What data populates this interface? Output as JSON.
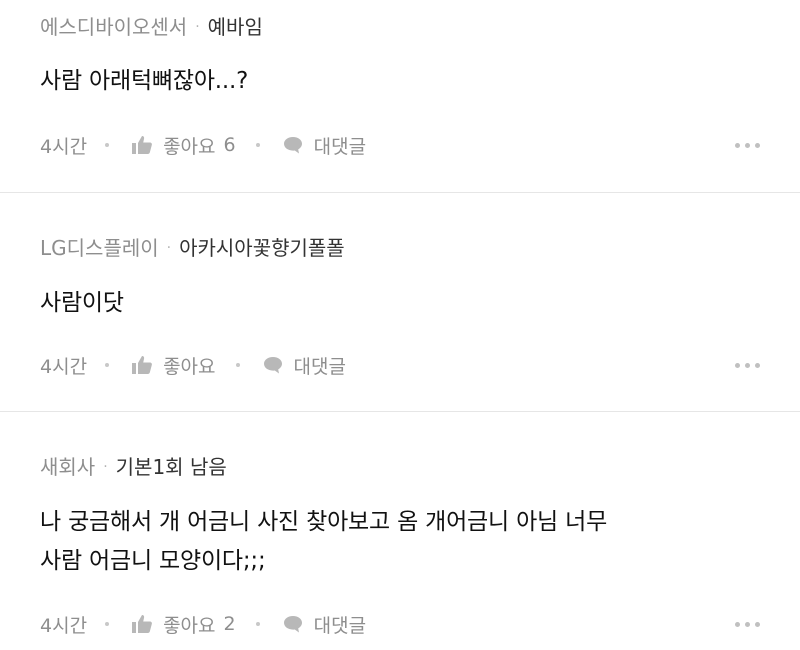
{
  "comments": [
    {
      "company": "에스디바이오센서",
      "separator": "·",
      "nickname": "예바임",
      "text": "사람 아래턱뼈잖아...?",
      "time": "4시간",
      "like_label": "좋아요",
      "like_count": "6",
      "reply_label": "대댓글"
    },
    {
      "company": "LG디스플레이",
      "separator": "·",
      "nickname": "아카시아꽃향기폴폴",
      "text": "사람이닷",
      "time": "4시간",
      "like_label": "좋아요",
      "like_count": "",
      "reply_label": "대댓글"
    },
    {
      "company": "새회사",
      "separator": "·",
      "nickname": "기본1회 남음",
      "text_lines": [
        "나 궁금해서 개 어금니 사진 찾아보고 옴 개어금니 아님 너무",
        "사람 어금니 모양이다;;;"
      ],
      "time": "4시간",
      "like_label": "좋아요",
      "like_count": "2",
      "reply_label": "대댓글"
    }
  ],
  "icons": {
    "like": "thumbs-up-icon",
    "reply": "speech-bubble-icon",
    "more": "more-horizontal-icon"
  },
  "colors": {
    "muted_text": "#8e8e8e",
    "divider": "#e6e6e6",
    "icon": "#b8b8b8"
  }
}
